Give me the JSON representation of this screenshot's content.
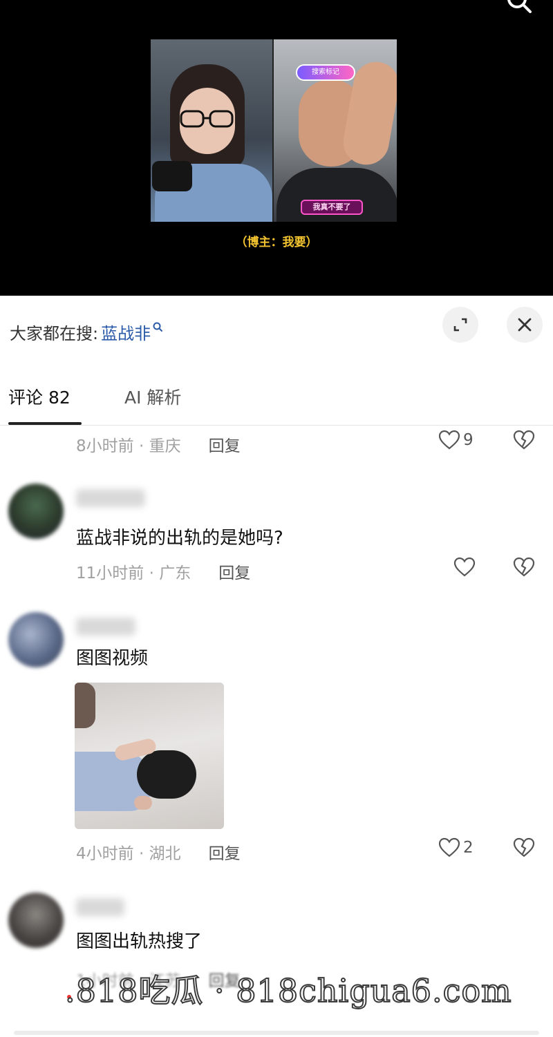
{
  "video": {
    "sticker_top": "搜索标记",
    "sticker_bottom": "我真不要了",
    "caption": "（博主：我要）"
  },
  "trending": {
    "prefix": "大家都在搜:",
    "keyword": "蓝战非"
  },
  "tabs": {
    "comments": "评论 82",
    "ai": "AI 解析"
  },
  "comments": [
    {
      "time_location": "8小时前 · 重庆",
      "reply": "回复",
      "likes": "9"
    },
    {
      "text": "蓝战非说的出轨的是她吗?",
      "time_location": "11小时前 · 广东",
      "reply": "回复",
      "likes": ""
    },
    {
      "text": "图图视频",
      "time_location": "4小时前 · 湖北",
      "reply": "回复",
      "likes": "2"
    },
    {
      "text": "图图出轨热搜了",
      "time_location": "1小时前 · 江苏",
      "reply": "回复"
    }
  ],
  "watermark": ".818吃瓜 · 818chigua6.com",
  "colors": {
    "link": "#2b5aa8",
    "meta": "#a0a0a0",
    "video_bg": "#000000"
  },
  "icons": [
    "search-icon",
    "expand-icon",
    "close-icon",
    "heart-icon",
    "broken-heart-icon"
  ]
}
